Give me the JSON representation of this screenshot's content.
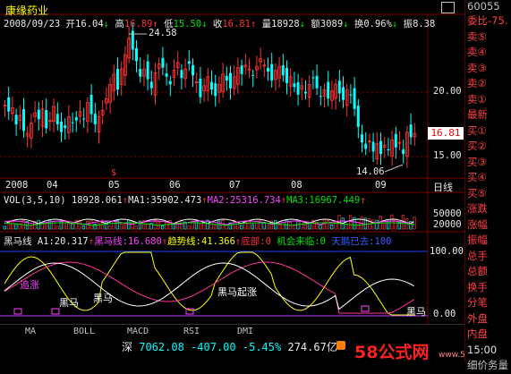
{
  "stock": {
    "name": "康缘药业",
    "date": "2008/09/23",
    "open_label": "开",
    "open": "16.04",
    "high_label": "高",
    "high": "16.89",
    "low_label": "低",
    "low": "15.50",
    "close_label": "收",
    "close": "16.81",
    "volume_label": "量",
    "volume": "18928",
    "amount_label": "额",
    "amount": "3089",
    "turnover_label": "换",
    "turnover": "0.96%",
    "amplitude_label": "振",
    "amplitude": "8.38"
  },
  "main_chart": {
    "price_labels": [
      "20.00",
      "15.00"
    ],
    "last_price_tag": "16.81",
    "max_annotation": "24.58",
    "min_annotation": "14.06",
    "period": "日线",
    "date_labels": [
      "2008",
      "04",
      "05",
      "06",
      "07",
      "08",
      "09"
    ],
    "marker_label": "$"
  },
  "volume_panel": {
    "title": "VOL(3,5,10)",
    "vol": "18928.061",
    "ma1": "MA1:35902.473",
    "ma2": "MA2:25316.734",
    "ma3": "MA3:16967.449",
    "scale_labels": [
      "50000",
      "20000"
    ]
  },
  "indicator_panel": {
    "title": "黑马线",
    "a1": "A1:20.317",
    "heima": "黑马线:16.680",
    "trend": "趋势线:41.366",
    "bottom": "底部:0",
    "chance": "机会来临:0",
    "sky": "天鹅已去:100",
    "scale_labels": [
      "100.00",
      "0.00"
    ],
    "annotations": [
      "追涨",
      "黑马",
      "黑马",
      "黑马起涨",
      "黑马"
    ]
  },
  "tabs": [
    "MA",
    "BOLL",
    "MACD",
    "RSI",
    "DMI"
  ],
  "status_bar": {
    "index_name": "深",
    "index_value": "7062.08",
    "change": "-407.00",
    "pct": "-5.45%",
    "amount": "274.67亿",
    "watermark": "58公式网",
    "url": "www.58gu.com"
  },
  "sidebar": {
    "code": "60055",
    "items": [
      "委比-75.",
      "卖⑤",
      "卖④",
      "卖③",
      "卖②",
      "卖①",
      "最新",
      "买①",
      "买②",
      "买③",
      "买④",
      "买⑤",
      "涨跌",
      "涨幅",
      "振幅",
      "总手",
      "总额",
      "换手",
      "分笔",
      "外盘",
      "内盘"
    ],
    "time": "15:00",
    "detail": "细价务量"
  },
  "colors": {
    "up": "#ff3333",
    "down": "#00ffff",
    "bg": "#000000",
    "yellow": "#ffff00",
    "magenta": "#ff40ff"
  }
}
